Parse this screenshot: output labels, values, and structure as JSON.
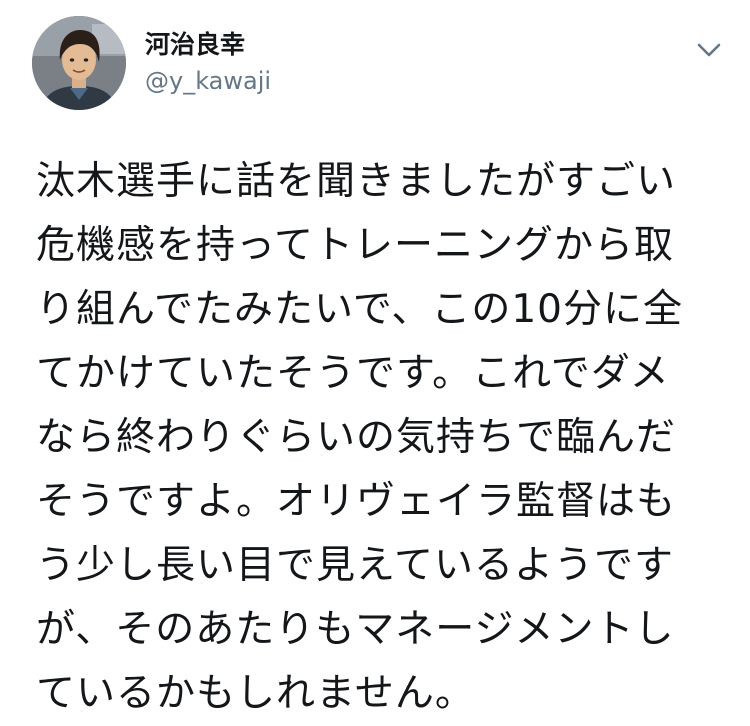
{
  "author": {
    "display_name": "河治良幸",
    "handle": "@y_kawaji",
    "avatar_icon": "user-avatar-photo"
  },
  "menu": {
    "caret_icon": "chevron-down-icon"
  },
  "tweet": {
    "lines": [
      "汰木選手に話を聞きましたがすごい",
      "危機感を持ってトレーニングから取",
      "り組んでたみたいで、この10分に全",
      "てかけていたそうです。これでダメ",
      "なら終わりぐらいの気持ちで臨んだ",
      "そうですよ。オリヴェイラ監督はも",
      "う少し長い目で見えているようです",
      "が、そのあたりもマネージメントし",
      "ているかもしれません。"
    ]
  },
  "colors": {
    "text": "#14171a",
    "secondary": "#657786",
    "background": "#ffffff"
  }
}
